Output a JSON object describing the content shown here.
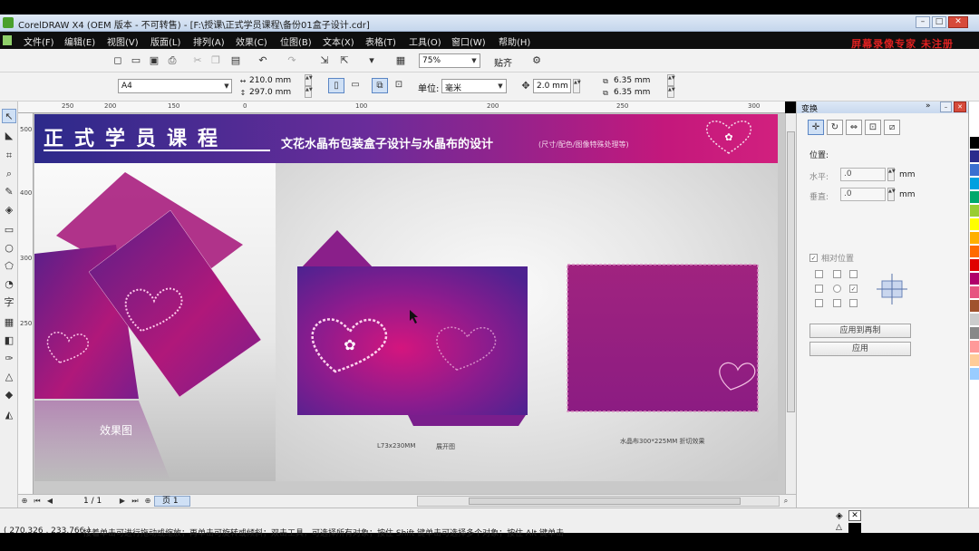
{
  "window": {
    "title": "CorelDRAW X4 (OEM 版本 - 不可转售) - [F:\\授课\\正式学员课程\\备份01盒子设计.cdr]",
    "minimize": "–",
    "maximize": "□",
    "close": "✕"
  },
  "menu": {
    "items": [
      "文件(F)",
      "编辑(E)",
      "视图(V)",
      "版面(L)",
      "排列(A)",
      "效果(C)",
      "位图(B)",
      "文本(X)",
      "表格(T)",
      "工具(O)",
      "窗口(W)",
      "帮助(H)"
    ],
    "promo": "屏幕录像专家  未注册"
  },
  "toolbar": {
    "zoom": "75%",
    "snap_label": "贴齐"
  },
  "propertybar": {
    "page_size": "A4",
    "width": "210.0 mm",
    "height": "297.0 mm",
    "units_label": "单位:",
    "units": "毫米",
    "nudge": "2.0 mm",
    "dup_x": "6.35 mm",
    "dup_y": "6.35 mm"
  },
  "ruler": {
    "top_ticks": [
      "250",
      "200",
      "150",
      "100",
      "50",
      "0",
      "50",
      "100",
      "150",
      "200",
      "250",
      "300"
    ],
    "left_ticks": [
      "500",
      "450",
      "400",
      "350",
      "300",
      "250",
      "200"
    ]
  },
  "artwork": {
    "main_title": "正式学员课程",
    "sub_title": "文花水晶布包装盒子设计与水晶布的设计",
    "sub_note": "(尺寸/配色/图像特殊处理等)",
    "effect_label": "效果图",
    "box_caption": "L73x230MM",
    "unfold_caption": "展开图",
    "cloth_caption": "水晶布300*225MM 折切效果"
  },
  "pagebar": {
    "page_count": "1 / 1",
    "page_tab": "页 1"
  },
  "docker": {
    "title": "变换",
    "position_label": "位置:",
    "h_label": "水平:",
    "v_label": "垂直:",
    "h_value": ".0",
    "v_value": ".0",
    "unit": "mm",
    "relative_label": "相对位置",
    "apply_dup": "应用到再制",
    "apply": "应用"
  },
  "status": {
    "coords": "( 270.326 , 233.766 )",
    "hint": "接着单击可进行拖动或缩放；再单击可旋转或倾斜；双击工具，可选择所有对象；按住 Shift 键单击可选择多个对象；按住 Alt 键单击"
  },
  "palette": [
    "#ffffff",
    "#000000",
    "#2b2b8c",
    "#3b6fd0",
    "#00a0e0",
    "#00a86b",
    "#9acd32",
    "#ffff00",
    "#ffb000",
    "#ff6a00",
    "#e00000",
    "#b0006a",
    "#e75480",
    "#a0522d",
    "#cccccc",
    "#888888",
    "#ff9999",
    "#ffcc99",
    "#99ccff"
  ],
  "colors": {
    "banner_start": "#2c2a8a",
    "banner_end": "#d1207e",
    "box_purple": "#7a1e8c",
    "cloth_magenta": "#9b1f82"
  }
}
